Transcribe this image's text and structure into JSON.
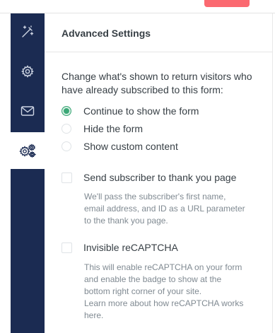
{
  "sidebar": {
    "items": [
      {
        "icon": "magic-wand-icon",
        "active": false
      },
      {
        "icon": "gear-icon",
        "active": false
      },
      {
        "icon": "envelope-icon",
        "active": false
      },
      {
        "icon": "gears-icon",
        "active": true
      }
    ]
  },
  "panel": {
    "title": "Advanced Settings",
    "intro": "Change what's shown to return visitors who have already subscribed to this form:",
    "return_visitor_options": [
      {
        "label": "Continue to show the form",
        "checked": true
      },
      {
        "label": "Hide the form",
        "checked": false
      },
      {
        "label": "Show custom content",
        "checked": false
      }
    ],
    "thank_you": {
      "label": "Send subscriber to thank you page",
      "checked": false,
      "help": [
        "We'll pass the subscriber's first name,",
        "email address, and ID as a URL parameter",
        "to the thank you page."
      ]
    },
    "recaptcha": {
      "label": "Invisible reCAPTCHA",
      "checked": false,
      "help": [
        "This will enable reCAPTCHA on your form",
        "and enable the badge to show at the",
        "bottom right corner of your site.",
        "Learn more about how reCAPTCHA works",
        "here."
      ]
    }
  },
  "colors": {
    "sidebar": "#1b2b52",
    "accent_button": "#fb6970",
    "radio_checked": "#3aa776",
    "help_text": "#808a92"
  }
}
